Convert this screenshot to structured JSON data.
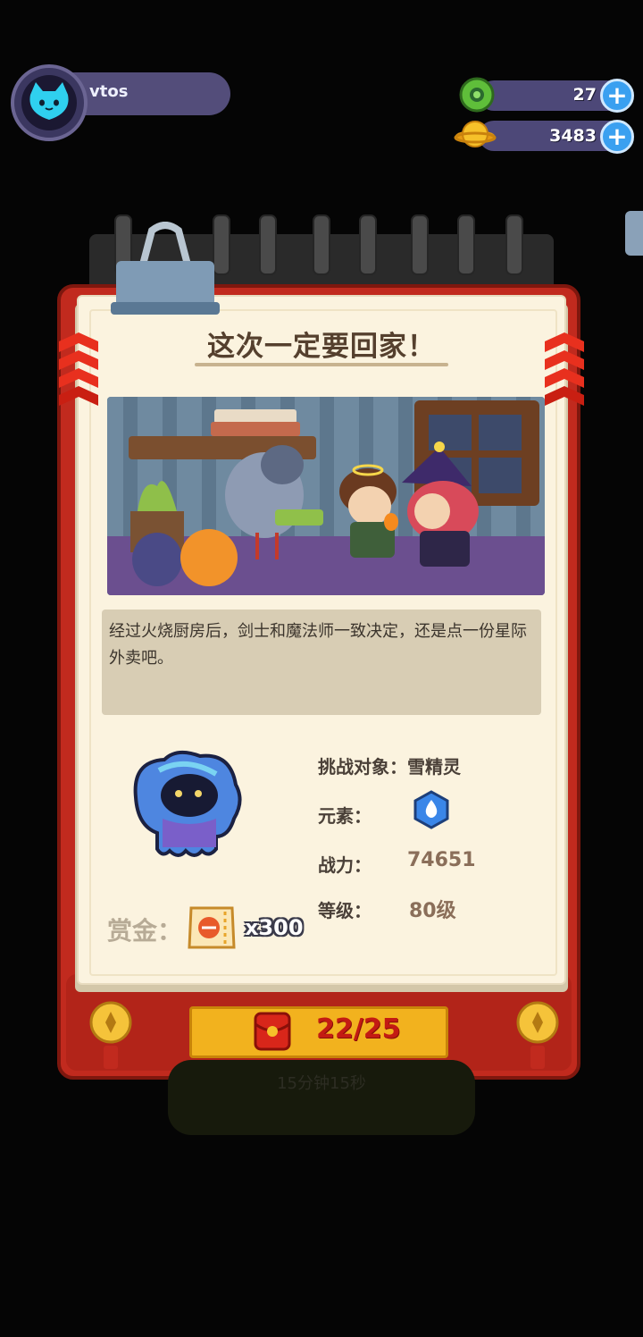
{
  "profile": {
    "username": "vtos"
  },
  "currencies": [
    {
      "name": "gems",
      "value": "27",
      "icon": "green-gem-icon",
      "add_label": "+"
    },
    {
      "name": "coins",
      "value": "3483",
      "icon": "gold-coin-icon",
      "add_label": "+"
    }
  ],
  "quest": {
    "title": "这次一定要回家！",
    "story": "经过火烧厨房后，剑士和魔法师一致决定，还是点一份星际外卖吧。",
    "target_label": "挑战对象：",
    "target_value": "雪精灵",
    "element_label": "元素：",
    "element_icon": "water-drop-icon",
    "power_label": "战力：",
    "power_value": "74651",
    "level_label": "等级：",
    "level_value": "80级",
    "reward_label": "赏金：",
    "reward_icon": "ticket-icon",
    "reward_value": "x300"
  },
  "action": {
    "icon": "red-envelope-icon",
    "count": "22/25",
    "hidden_text": "15分钟15秒"
  },
  "colors": {
    "frame_red": "#c12a1e",
    "paper": "#fbf3df",
    "button_gold": "#f2b21e",
    "count_red": "#c31b13"
  }
}
